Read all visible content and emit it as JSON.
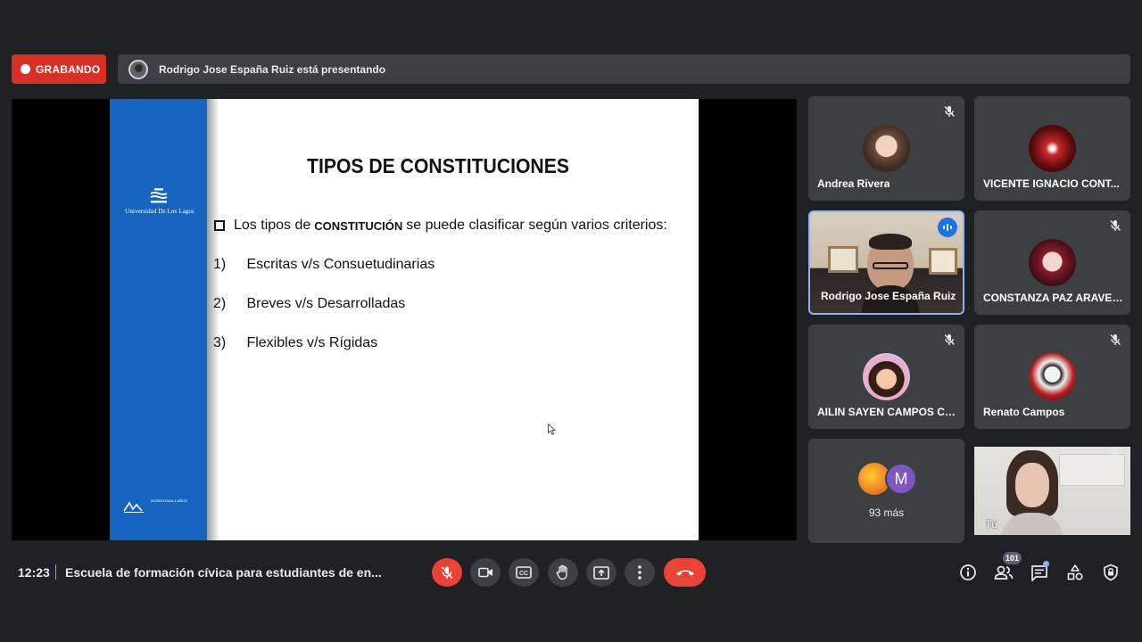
{
  "recording": {
    "label": "GRABANDO"
  },
  "presenting": {
    "text": "Rodrigo Jose España Ruiz está presentando"
  },
  "slide": {
    "university": "Universidad De Los Lagos",
    "accreditation_text": "ACREDITADA 4 AÑOS",
    "title": "TIPOS DE CONSTITUCIONES",
    "intro_before": "Los tipos de",
    "intro_strong": "CONSTITUCIÓN",
    "intro_after": "se puede clasificar según varios criterios:",
    "items": [
      {
        "num": "1)",
        "text": "Escritas v/s Consuetudinarias"
      },
      {
        "num": "2)",
        "text": "Breves v/s Desarrolladas"
      },
      {
        "num": "3)",
        "text": "Flexibles v/s Rígidas"
      }
    ]
  },
  "participants": [
    {
      "name": "Andrea Rivera",
      "muted": true
    },
    {
      "name": "VICENTE IGNACIO CONT...",
      "muted": false
    },
    {
      "name": "Rodrigo Jose España Ruiz",
      "speaking": true
    },
    {
      "name": "CONSTANZA PAZ ARAVEN...",
      "muted": true
    },
    {
      "name": "AILIN SAYEN CAMPOS CA...",
      "muted": true
    },
    {
      "name": "Renato Campos",
      "muted": true
    },
    {
      "name": "Tú",
      "muted": true
    }
  ],
  "more": {
    "avatar_letter": "M",
    "label": "93 más"
  },
  "bottom": {
    "clock": "12:23",
    "meeting_title": "Escuela de formación cívica para estudiantes de en...",
    "people_count": "101"
  },
  "colors": {
    "accent": "#8ab4f8",
    "danger": "#ea4335",
    "slide_band": "#1565c0"
  }
}
